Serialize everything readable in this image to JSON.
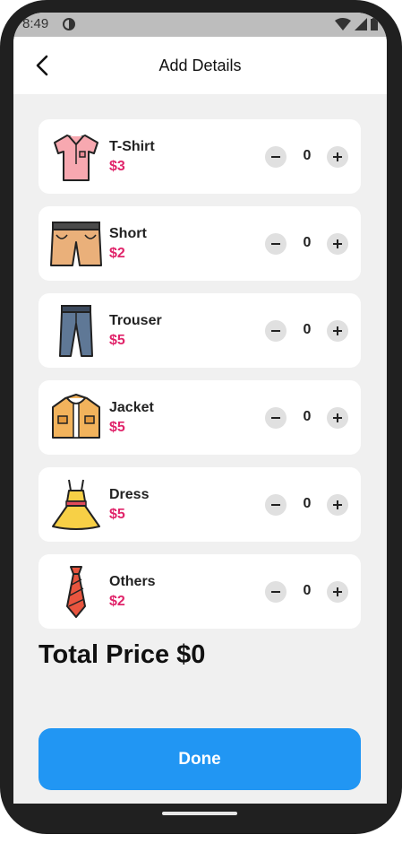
{
  "status_bar": {
    "time": "8:49"
  },
  "app_bar": {
    "title": "Add Details"
  },
  "items": [
    {
      "name": "T-Shirt",
      "price": "$3",
      "qty": "0",
      "icon": "tshirt-icon"
    },
    {
      "name": "Short",
      "price": "$2",
      "qty": "0",
      "icon": "shorts-icon"
    },
    {
      "name": "Trouser",
      "price": "$5",
      "qty": "0",
      "icon": "trouser-icon"
    },
    {
      "name": "Jacket",
      "price": "$5",
      "qty": "0",
      "icon": "jacket-icon"
    },
    {
      "name": "Dress",
      "price": "$5",
      "qty": "0",
      "icon": "dress-icon"
    },
    {
      "name": "Others",
      "price": "$2",
      "qty": "0",
      "icon": "tie-icon"
    }
  ],
  "total": {
    "text": "Total Price $0"
  },
  "done_button": {
    "label": "Done"
  },
  "colors": {
    "accent": "#2196f3",
    "price": "#e0246a",
    "background": "#f0f0f0"
  }
}
